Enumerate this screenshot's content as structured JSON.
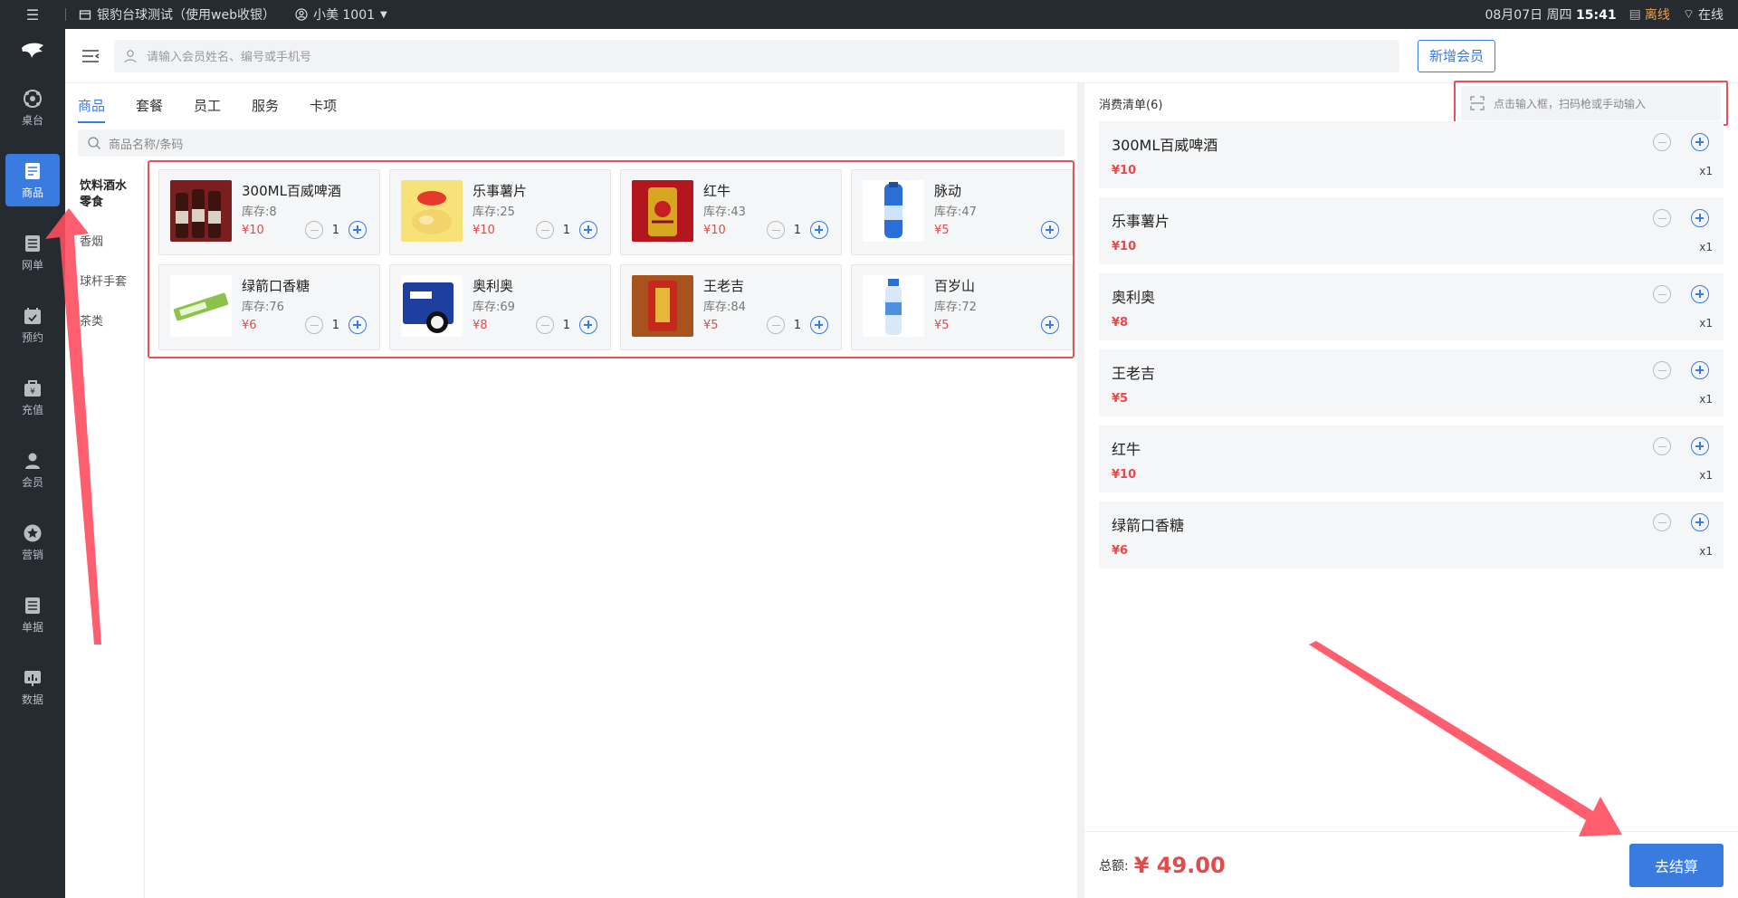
{
  "topbar": {
    "store": "银豹台球测试（使用web收银）",
    "user": "小美 1001",
    "date": "08月07日 周四",
    "time": "15:41",
    "offline": "离线",
    "online": "在线"
  },
  "sidebar": {
    "items": [
      {
        "label": "桌台",
        "icon": "table-icon"
      },
      {
        "label": "商品",
        "icon": "goods-icon",
        "active": true
      },
      {
        "label": "网单",
        "icon": "online-order-icon"
      },
      {
        "label": "预约",
        "icon": "calendar-icon"
      },
      {
        "label": "充值",
        "icon": "recharge-icon"
      },
      {
        "label": "会员",
        "icon": "member-icon"
      },
      {
        "label": "营销",
        "icon": "star-icon"
      },
      {
        "label": "单据",
        "icon": "document-icon"
      },
      {
        "label": "数据",
        "icon": "chart-icon"
      }
    ]
  },
  "header": {
    "member_search_placeholder": "请输入会员姓名、编号或手机号",
    "new_member": "新增会员"
  },
  "tabs": [
    "商品",
    "套餐",
    "员工",
    "服务",
    "卡项"
  ],
  "goods_search_placeholder": "商品名称/条码",
  "categories": [
    "饮料酒水零食",
    "香烟",
    "球杆手套",
    "茶类"
  ],
  "products": [
    {
      "name": "300ML百威啤酒",
      "stock": "库存:8",
      "price": "¥10",
      "qty": "1",
      "thumb": "beer"
    },
    {
      "name": "乐事薯片",
      "stock": "库存:25",
      "price": "¥10",
      "qty": "1",
      "thumb": "chips"
    },
    {
      "name": "红牛",
      "stock": "库存:43",
      "price": "¥10",
      "qty": "1",
      "thumb": "redbull"
    },
    {
      "name": "脉动",
      "stock": "库存:47",
      "price": "¥5",
      "qty": "",
      "thumb": "water"
    },
    {
      "name": "绿箭口香糖",
      "stock": "库存:76",
      "price": "¥6",
      "qty": "1",
      "thumb": "gum"
    },
    {
      "name": "奥利奥",
      "stock": "库存:69",
      "price": "¥8",
      "qty": "1",
      "thumb": "oreo"
    },
    {
      "name": "王老吉",
      "stock": "库存:84",
      "price": "¥5",
      "qty": "1",
      "thumb": "tea"
    },
    {
      "name": "百岁山",
      "stock": "库存:72",
      "price": "¥5",
      "qty": "",
      "thumb": "bottle"
    }
  ],
  "cart": {
    "title": "消费清单(6)",
    "scan_placeholder": "点击输入框，扫码枪或手动输入",
    "items": [
      {
        "name": "300ML百威啤酒",
        "price": "¥10",
        "count": "x1"
      },
      {
        "name": "乐事薯片",
        "price": "¥10",
        "count": "x1"
      },
      {
        "name": "奥利奥",
        "price": "¥8",
        "count": "x1"
      },
      {
        "name": "王老吉",
        "price": "¥5",
        "count": "x1"
      },
      {
        "name": "红牛",
        "price": "¥10",
        "count": "x1"
      },
      {
        "name": "绿箭口香糖",
        "price": "¥6",
        "count": "x1"
      }
    ],
    "total_label": "总额:",
    "total": "¥ 49.00",
    "checkout": "去结算"
  },
  "colors": {
    "accent": "#3a7be0",
    "price": "#e24b4b",
    "annotation": "#ff4d5e",
    "sidebar": "#262a31"
  }
}
